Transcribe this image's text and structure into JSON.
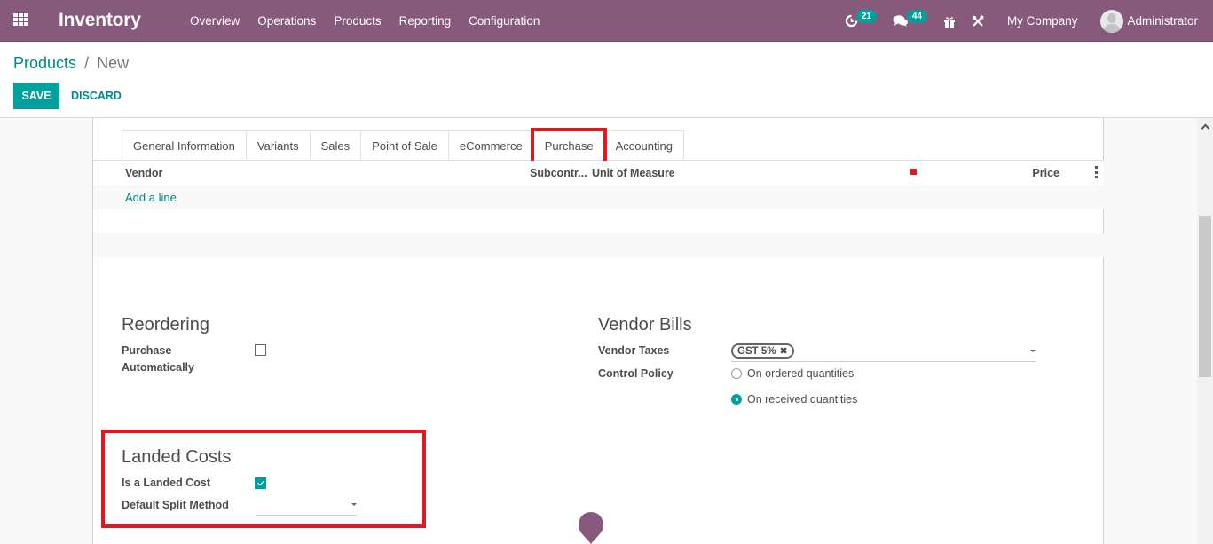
{
  "navbar": {
    "app_title": "Inventory",
    "menu": [
      "Overview",
      "Operations",
      "Products",
      "Reporting",
      "Configuration"
    ],
    "activity_count": "21",
    "messages_count": "44",
    "company": "My Company",
    "user": "Administrator",
    "icons": {
      "apps": "apps-grid-icon",
      "activity": "clock-icon",
      "messages": "chat-bubbles-icon",
      "gift": "gift-icon",
      "debug": "tools-icon"
    }
  },
  "breadcrumb": {
    "parent": "Products",
    "separator": "/",
    "current": "New"
  },
  "buttons": {
    "save": "SAVE",
    "discard": "DISCARD"
  },
  "tabs": [
    {
      "label": "General Information",
      "active": false
    },
    {
      "label": "Variants",
      "active": false
    },
    {
      "label": "Sales",
      "active": false
    },
    {
      "label": "Point of Sale",
      "active": false
    },
    {
      "label": "eCommerce",
      "active": false
    },
    {
      "label": "Purchase",
      "active": true
    },
    {
      "label": "Accounting",
      "active": false
    }
  ],
  "vendor_table": {
    "columns": {
      "vendor": "Vendor",
      "subcontractor": "Subcontr...",
      "uom": "Unit of Measure",
      "price": "Price"
    },
    "add_line": "Add a line"
  },
  "reordering": {
    "title": "Reordering",
    "purchase_auto_label_line1": "Purchase",
    "purchase_auto_label_line2": "Automatically",
    "purchase_auto_checked": false
  },
  "vendor_bills": {
    "title": "Vendor Bills",
    "vendor_taxes_label": "Vendor Taxes",
    "vendor_taxes_tag": "GST 5%",
    "control_policy_label": "Control Policy",
    "control_policy_options": [
      {
        "label": "On ordered quantities",
        "checked": false
      },
      {
        "label": "On received quantities",
        "checked": true
      }
    ]
  },
  "landed_costs": {
    "title": "Landed Costs",
    "is_landed_cost_label": "Is a Landed Cost",
    "is_landed_cost_checked": true,
    "split_method_label": "Default Split Method",
    "split_method_value": ""
  },
  "colors": {
    "brand": "#875a7b",
    "accent": "#00a09d",
    "link": "#00878a",
    "highlight": "#e3181f"
  }
}
